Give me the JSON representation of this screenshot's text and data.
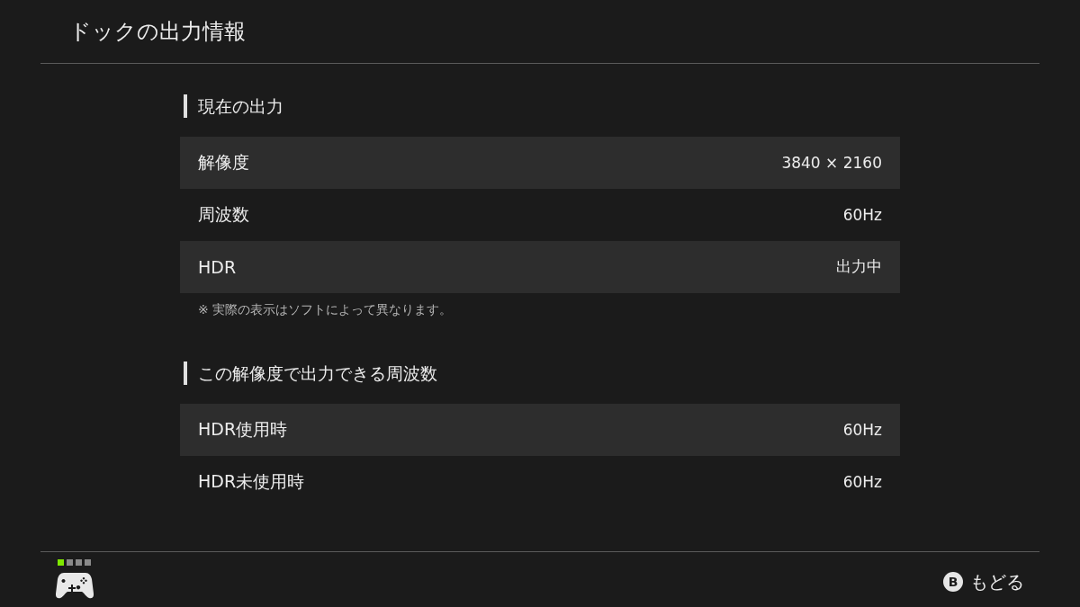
{
  "header": {
    "title": "ドックの出力情報"
  },
  "sections": [
    {
      "heading": "現在の出力",
      "rows": [
        {
          "label": "解像度",
          "value": "3840 × 2160"
        },
        {
          "label": "周波数",
          "value": "60Hz"
        },
        {
          "label": "HDR",
          "value": "出力中"
        }
      ],
      "note": "※ 実際の表示はソフトによって異なります。"
    },
    {
      "heading": "この解像度で出力できる周波数",
      "rows": [
        {
          "label": "HDR使用時",
          "value": "60Hz"
        },
        {
          "label": "HDR未使用時",
          "value": "60Hz"
        }
      ]
    }
  ],
  "footer": {
    "player_lights": [
      {
        "on": true
      },
      {
        "on": false
      },
      {
        "on": false
      },
      {
        "on": false
      }
    ],
    "back_button": {
      "key": "B",
      "label": "もどる"
    }
  }
}
